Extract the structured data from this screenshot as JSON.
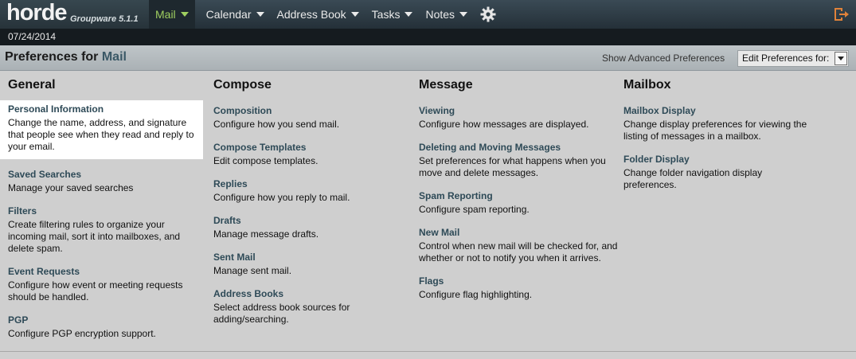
{
  "brand": {
    "name": "horde",
    "version": "Groupware 5.1.1"
  },
  "nav": [
    {
      "label": "Mail",
      "active": true
    },
    {
      "label": "Calendar",
      "active": false
    },
    {
      "label": "Address Book",
      "active": false
    },
    {
      "label": "Tasks",
      "active": false
    },
    {
      "label": "Notes",
      "active": false
    }
  ],
  "icons": {
    "settings": "gear-icon",
    "logout": "logout-icon"
  },
  "date": "07/24/2014",
  "header": {
    "title_prefix": "Preferences for",
    "app_name": "Mail",
    "advanced_link": "Show Advanced Preferences",
    "edit_select_value": "Edit Preferences for:"
  },
  "columns": [
    {
      "heading": "General",
      "items": [
        {
          "title": "Personal Information",
          "desc": "Change the name, address, and signature that people see when they read and reply to your email.",
          "highlighted": true
        },
        {
          "title": "Saved Searches",
          "desc": "Manage your saved searches"
        },
        {
          "title": "Filters",
          "desc": "Create filtering rules to organize your incoming mail, sort it into mailboxes, and delete spam."
        },
        {
          "title": "Event Requests",
          "desc": "Configure how event or meeting requests should be handled."
        },
        {
          "title": "PGP",
          "desc": "Configure PGP encryption support."
        }
      ]
    },
    {
      "heading": "Compose",
      "items": [
        {
          "title": "Composition",
          "desc": "Configure how you send mail."
        },
        {
          "title": "Compose Templates",
          "desc": "Edit compose templates."
        },
        {
          "title": "Replies",
          "desc": "Configure how you reply to mail."
        },
        {
          "title": "Drafts",
          "desc": "Manage message drafts."
        },
        {
          "title": "Sent Mail",
          "desc": "Manage sent mail."
        },
        {
          "title": "Address Books",
          "desc": "Select address book sources for adding/searching."
        }
      ]
    },
    {
      "heading": "Message",
      "items": [
        {
          "title": "Viewing",
          "desc": "Configure how messages are displayed."
        },
        {
          "title": "Deleting and Moving Messages",
          "desc": "Set preferences for what happens when you move and delete messages."
        },
        {
          "title": "Spam Reporting",
          "desc": "Configure spam reporting."
        },
        {
          "title": "New Mail",
          "desc": "Control when new mail will be checked for, and whether or not to notify you when it arrives."
        },
        {
          "title": "Flags",
          "desc": "Configure flag highlighting."
        }
      ]
    },
    {
      "heading": "Mailbox",
      "items": [
        {
          "title": "Mailbox Display",
          "desc": "Change display preferences for viewing the listing of messages in a mailbox."
        },
        {
          "title": "Folder Display",
          "desc": "Change folder navigation display preferences."
        }
      ]
    }
  ]
}
